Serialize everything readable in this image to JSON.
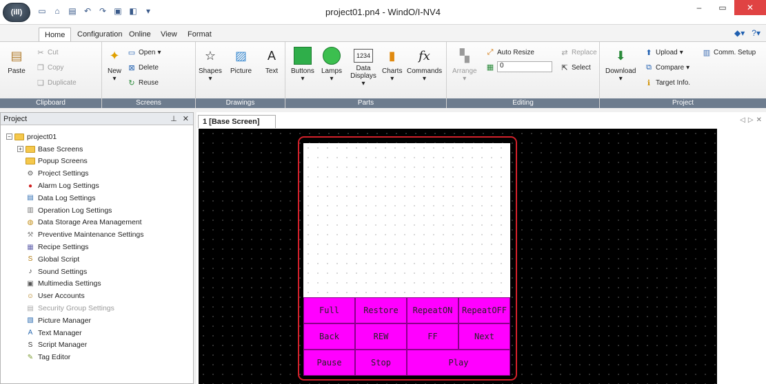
{
  "window": {
    "title": "project01.pn4 - WindO/I-NV4",
    "app_button": "(ill)"
  },
  "ribbon_tabs": [
    "Home",
    "Configuration",
    "Online",
    "View",
    "Format"
  ],
  "ribbon": {
    "clipboard": {
      "label": "Clipboard",
      "paste": "Paste",
      "cut": "Cut",
      "copy": "Copy",
      "duplicate": "Duplicate"
    },
    "screens": {
      "label": "Screens",
      "new": "New",
      "open": "Open",
      "delete": "Delete",
      "reuse": "Reuse"
    },
    "drawings": {
      "label": "Drawings",
      "shapes": "Shapes",
      "picture": "Picture",
      "text": "Text"
    },
    "parts": {
      "label": "Parts",
      "buttons": "Buttons",
      "lamps": "Lamps",
      "data_displays": "Data Displays",
      "charts": "Charts",
      "commands": "Commands"
    },
    "editing": {
      "label": "Editing",
      "arrange": "Arrange",
      "auto_resize": "Auto Resize",
      "replace": "Replace",
      "select": "Select",
      "spin_value": "0"
    },
    "project": {
      "label": "Project",
      "download": "Download",
      "upload": "Upload",
      "comm_setup": "Comm. Setup",
      "compare": "Compare",
      "target_info": "Target Info."
    }
  },
  "project_panel": {
    "title": "Project",
    "root": "project01",
    "items": [
      "Base Screens",
      "Popup Screens",
      "Project Settings",
      "Alarm Log Settings",
      "Data Log Settings",
      "Operation Log Settings",
      "Data Storage Area Management",
      "Preventive Maintenance Settings",
      "Recipe Settings",
      "Global Script",
      "Sound Settings",
      "Multimedia Settings",
      "User Accounts",
      "Security Group Settings",
      "Picture Manager",
      "Text Manager",
      "Script Manager",
      "Tag Editor"
    ]
  },
  "editor": {
    "tab_title": "1 [Base Screen]",
    "buttons": [
      "Full",
      "Restore",
      "RepeatON",
      "RepeatOFF",
      "Back",
      "REW",
      "FF",
      "Next",
      "Pause",
      "Stop",
      "Play"
    ]
  },
  "colors": {
    "hmi_button": "#ff00ff",
    "highlight": "#d5212b",
    "canvas": "#000000"
  }
}
